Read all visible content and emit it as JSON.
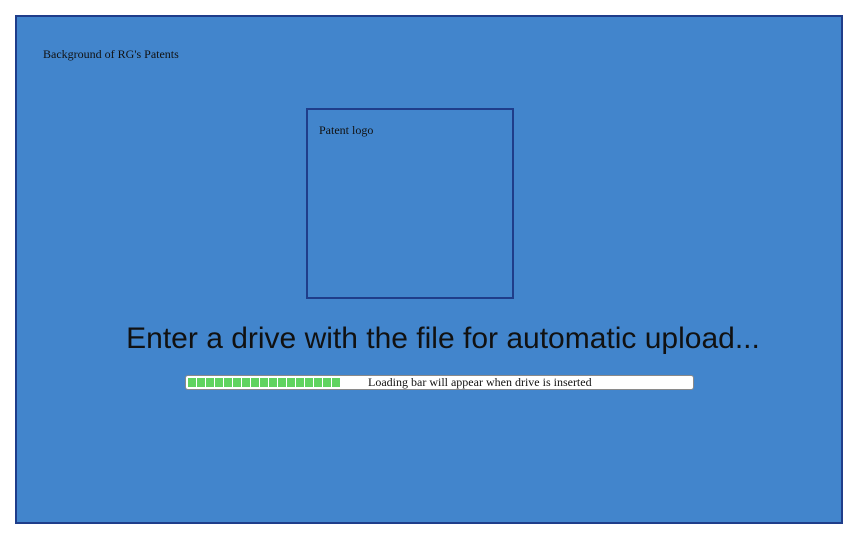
{
  "background_label": "Background of RG's Patents",
  "logo": {
    "label": "Patent logo"
  },
  "prompt_text": "Enter a drive with the file for automatic upload...",
  "progress": {
    "status_text": "Loading bar will appear when drive is inserted",
    "fill_fraction": 0.34,
    "segment_count": 17,
    "fill_color": "#5fd35f"
  },
  "colors": {
    "background": "#4285cc",
    "border": "#1f3d8a"
  }
}
